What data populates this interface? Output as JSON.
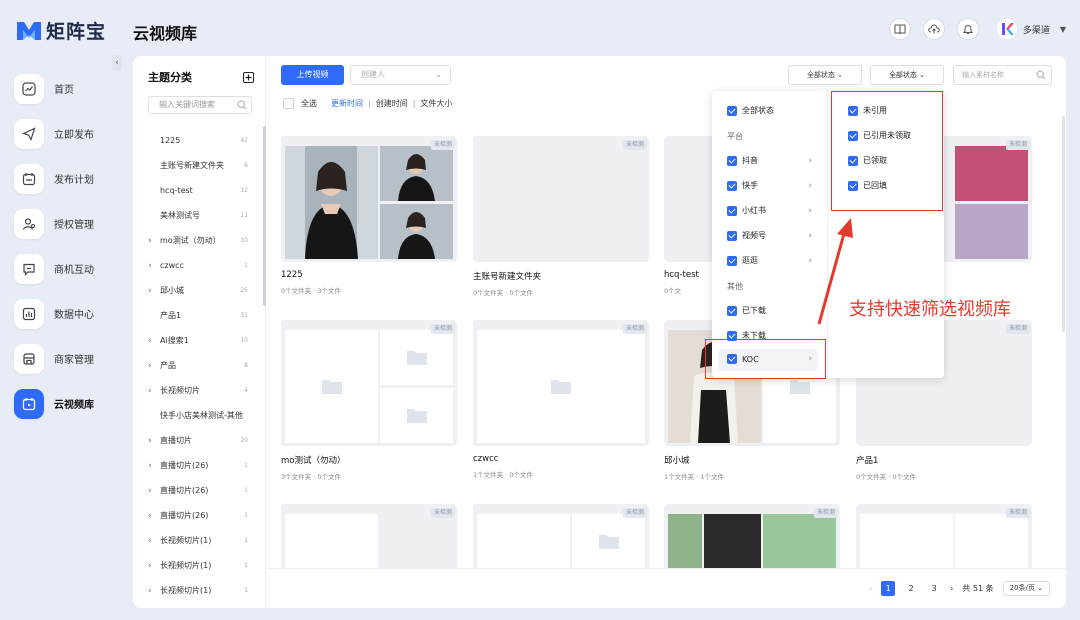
{
  "app": {
    "name": "矩阵宝",
    "page_title": "云视频库"
  },
  "nav": [
    {
      "id": "home",
      "label": "首页"
    },
    {
      "id": "publish",
      "label": "立即发布"
    },
    {
      "id": "plan",
      "label": "发布计划"
    },
    {
      "id": "auth",
      "label": "授权管理"
    },
    {
      "id": "biz",
      "label": "商机互动"
    },
    {
      "id": "data",
      "label": "数据中心"
    },
    {
      "id": "merchant",
      "label": "商家管理"
    },
    {
      "id": "cloud",
      "label": "云视频库",
      "active": true
    }
  ],
  "user": {
    "name": "多渠道"
  },
  "tree": {
    "title": "主题分类",
    "search_placeholder": "输入关键词搜索",
    "items": [
      {
        "label": "1225",
        "count": "42",
        "expandable": false
      },
      {
        "label": "主账号新建文件夹",
        "count": "6",
        "expandable": false
      },
      {
        "label": "hcq-test",
        "count": "12",
        "expandable": false
      },
      {
        "label": "美林测试号",
        "count": "11",
        "expandable": false
      },
      {
        "label": "mo测试（勿动）",
        "count": "10",
        "expandable": true
      },
      {
        "label": "czwcc",
        "count": "1",
        "expandable": true
      },
      {
        "label": "邱小城",
        "count": "25",
        "expandable": true
      },
      {
        "label": "产品1",
        "count": "31",
        "expandable": false
      },
      {
        "label": "Ai搜索1",
        "count": "10",
        "expandable": true
      },
      {
        "label": "产品",
        "count": "8",
        "expandable": true
      },
      {
        "label": "长视频切片",
        "count": "4",
        "expandable": true
      },
      {
        "label": "快手小店美林测试-其他",
        "count": "",
        "expandable": false
      },
      {
        "label": "直播切片",
        "count": "20",
        "expandable": true
      },
      {
        "label": "直播切片(26)",
        "count": "1",
        "expandable": true
      },
      {
        "label": "直播切片(26)",
        "count": "1",
        "expandable": true
      },
      {
        "label": "直播切片(26)",
        "count": "1",
        "expandable": true
      },
      {
        "label": "长视频切片(1)",
        "count": "1",
        "expandable": true
      },
      {
        "label": "长视频切片(1)",
        "count": "1",
        "expandable": true
      },
      {
        "label": "长视频切片(1)",
        "count": "1",
        "expandable": true
      }
    ]
  },
  "toolbar": {
    "upload_label": "上传视频",
    "creator_placeholder": "创建人",
    "status1_label": "全部状态",
    "status2_label": "全部状态",
    "search_placeholder": "输入素材名称"
  },
  "sortbar": {
    "select_all": "全选",
    "sort_update": "更新时间",
    "sort_create": "创建时间",
    "sort_size": "文件大小"
  },
  "badge_text": "未检测",
  "cards": [
    {
      "name": "1225",
      "meta": "0个文件夹 · 3个文件"
    },
    {
      "name": "主账号新建文件夹",
      "meta": "0个文件夹 · 0个文件"
    },
    {
      "name": "hcq-test",
      "meta": "0个文"
    },
    {
      "name": "",
      "meta": ""
    },
    {
      "name": "mo测试（勿动）",
      "meta": "3个文件夹 · 0个文件"
    },
    {
      "name": "czwcc",
      "meta": "1个文件夹 · 0个文件"
    },
    {
      "name": "邱小城",
      "meta": "1个文件夹 · 1个文件"
    },
    {
      "name": "产品1",
      "meta": "0个文件夹 · 0个文件"
    }
  ],
  "pager": {
    "pages": [
      "1",
      "2",
      "3"
    ],
    "current": "1",
    "total": "共 51 条",
    "page_size": "20条/页"
  },
  "filter": {
    "left": {
      "all": "全部状态",
      "platform_group": "平台",
      "platforms": [
        "抖音",
        "快手",
        "小红书",
        "视频号",
        "逛逛"
      ],
      "other_group": "其他",
      "others": [
        "已下载",
        "未下载"
      ],
      "koc": "KOC"
    },
    "right": [
      "未引用",
      "已引用未领取",
      "已领取",
      "已回填"
    ]
  },
  "annotation": "支持快速筛选视频库",
  "colors": {
    "primary": "#2f6bf6",
    "annotation": "#e23a2e"
  }
}
